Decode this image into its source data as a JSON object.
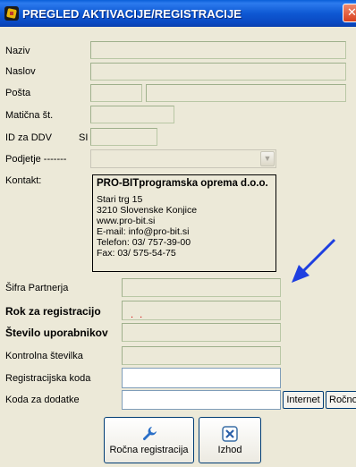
{
  "window": {
    "title": "PREGLED AKTIVACIJE/REGISTRACIJE",
    "close_label": "✕"
  },
  "labels": {
    "naziv": "Naziv",
    "naslov": "Naslov",
    "posta": "Pošta",
    "maticna": "Matična št.",
    "ddv": "ID za DDV",
    "ddv_prefix": "SI",
    "podjetje": "Podjetje -------",
    "kontakt": "Kontakt:",
    "sifra": "Šifra Partnerja",
    "rok": "Rok za registracijo",
    "uporabniki": "Število uporabnikov",
    "kontrolna": "Kontrolna številka",
    "reg_koda": "Registracijska koda",
    "koda_dodatke": "Koda za dodatke"
  },
  "contact": {
    "company": "PRO-BITprogramska oprema d.o.o.",
    "lines": [
      "Stari trg 15",
      "3210 Slovenske Konjice",
      "www.pro-bit.si",
      "E-mail: info@pro-bit.si",
      "Telefon: 03/ 757-39-00",
      "Fax: 03/ 575-54-75"
    ]
  },
  "rok_value": ". .",
  "buttons": {
    "internet": "Internet",
    "rocno": "Ročno",
    "rocna_registracija": "Ročna registracija",
    "izhod": "Izhod"
  },
  "colors": {
    "titlebar": "#0A58D3",
    "window_bg": "#ECE9D8",
    "arrow": "#1E3FE0"
  }
}
